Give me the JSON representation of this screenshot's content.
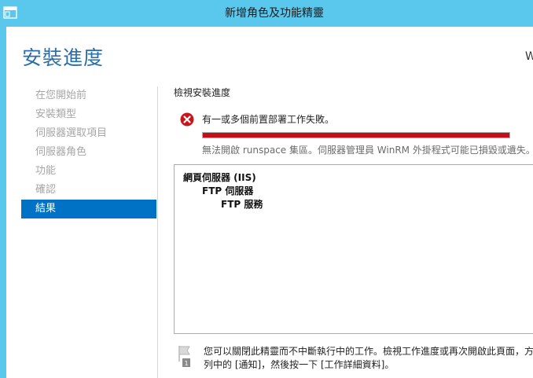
{
  "window": {
    "title": "新增角色及功能精靈"
  },
  "page": {
    "title": "安裝進度",
    "server_name": "W"
  },
  "nav": {
    "items": [
      {
        "label": "在您開始前",
        "active": false
      },
      {
        "label": "安裝類型",
        "active": false
      },
      {
        "label": "伺服器選取項目",
        "active": false
      },
      {
        "label": "伺服器角色",
        "active": false
      },
      {
        "label": "功能",
        "active": false
      },
      {
        "label": "確認",
        "active": false
      },
      {
        "label": "結果",
        "active": true
      }
    ]
  },
  "progress": {
    "section_label": "檢視安裝進度",
    "status_text": "有一或多個前置部署工作失敗。",
    "detail_text": "無法開啟 runspace 集區。伺服器管理員 WinRM 外掛程式可能已損毀或遺失。",
    "percent": 100,
    "bar_color": "#c1101a"
  },
  "results": {
    "items": [
      {
        "label": "網頁伺服器 (IIS)",
        "level": 0
      },
      {
        "label": "FTP 伺服器",
        "level": 1
      },
      {
        "label": "FTP 服務",
        "level": 2
      }
    ]
  },
  "footer": {
    "line1": "您可以關閉此精靈而不中斷執行中的工作。檢視工作進度或再次開啟此頁面，方",
    "line2": "列中的 [通知]，然後按一下 [工作詳細資料]。",
    "icon": "flag-icon"
  },
  "colors": {
    "titlebar": "#5ac8ec",
    "accent": "#0072c6",
    "page_title": "#2a6fa8",
    "error": "#c1101a"
  }
}
